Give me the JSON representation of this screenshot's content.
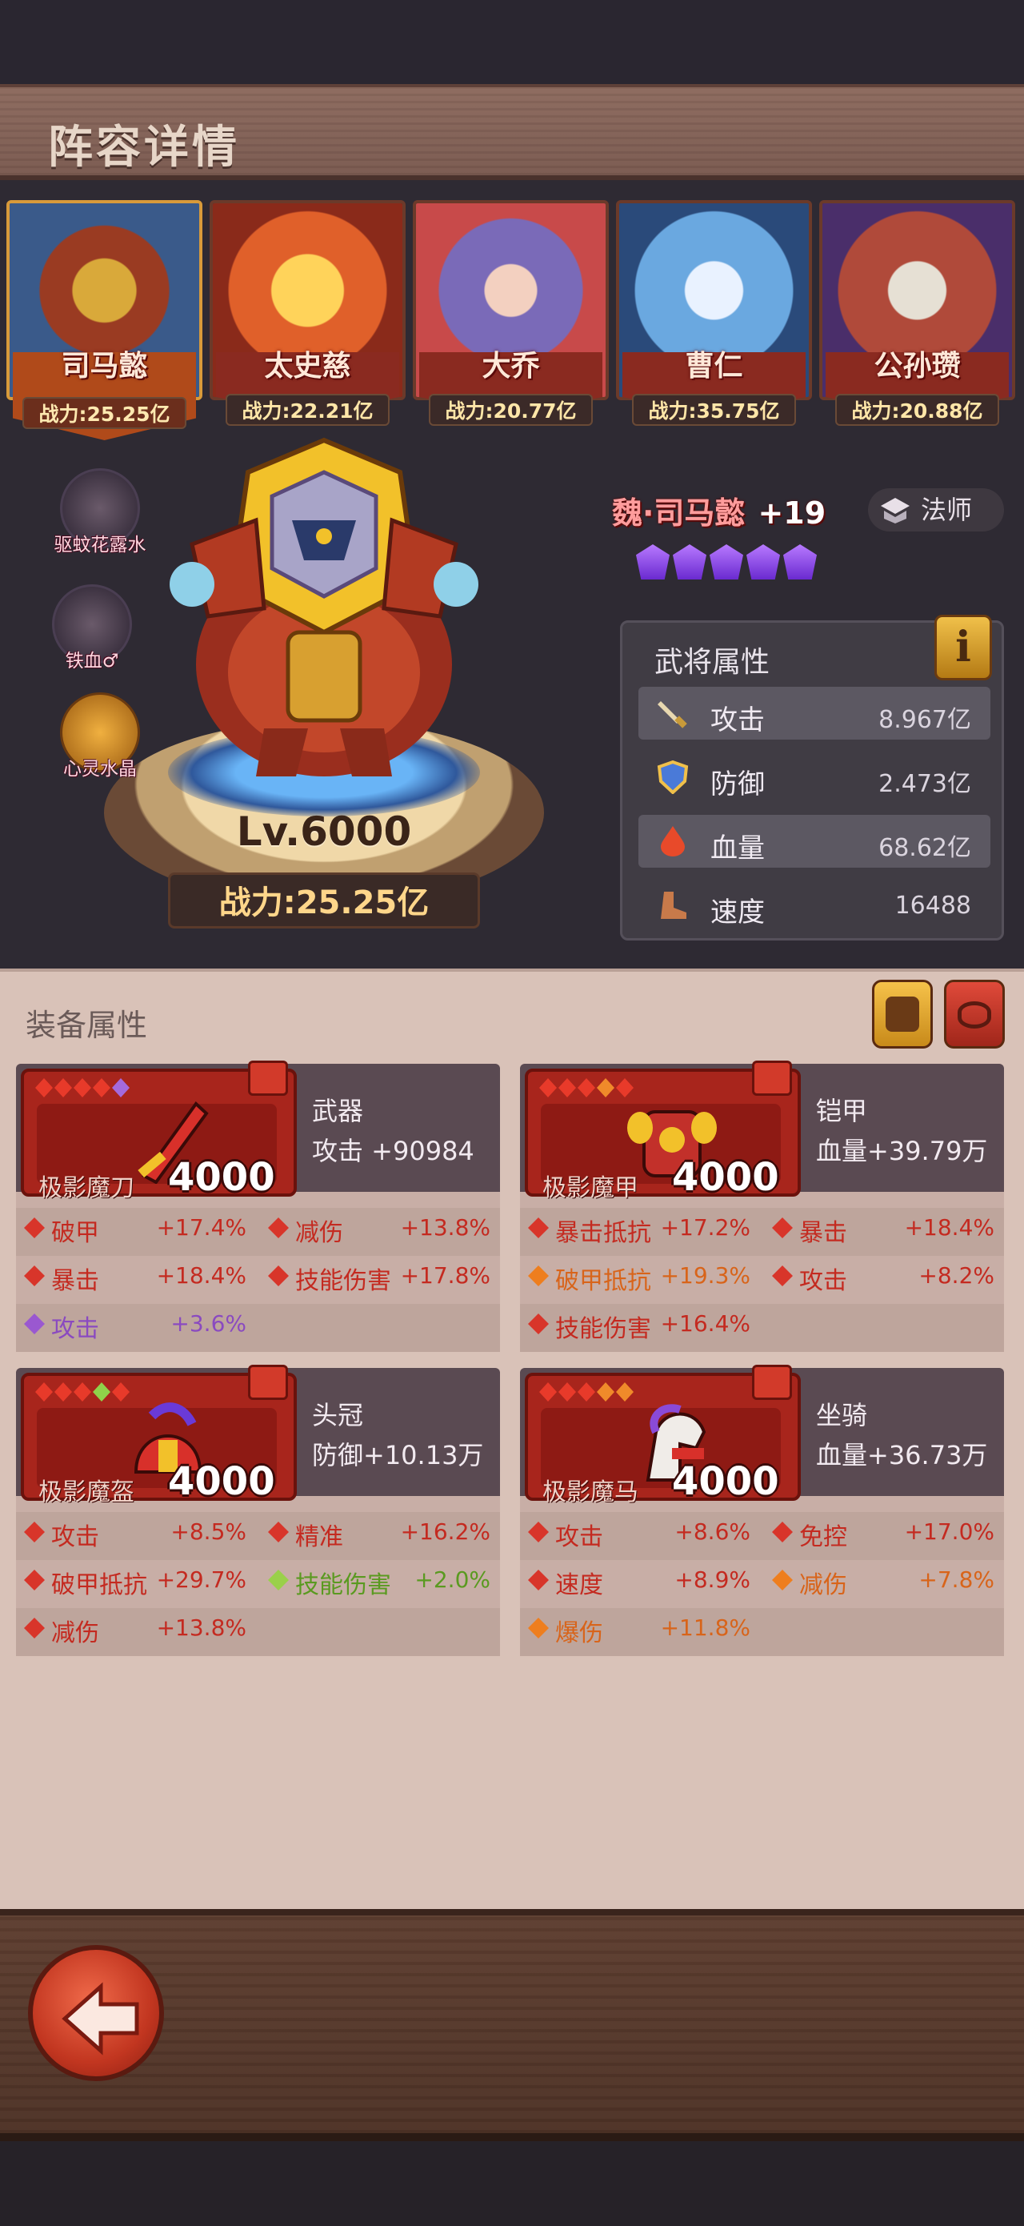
{
  "header": {
    "title": "阵容详情",
    "build_id": "189035361|12772|fba4|28"
  },
  "team": [
    {
      "name": "司马懿",
      "power": "战力:25.25亿",
      "selected": true
    },
    {
      "name": "太史慈",
      "power": "战力:22.21亿",
      "selected": false
    },
    {
      "name": "大乔",
      "power": "战力:20.77亿",
      "selected": false
    },
    {
      "name": "曹仁",
      "power": "战力:35.75亿",
      "selected": false
    },
    {
      "name": "公孙瓒",
      "power": "战力:20.88亿",
      "selected": false
    }
  ],
  "hero": {
    "full_name": "魏·司马懿",
    "plus": "+19",
    "class": "法师",
    "stars": 5,
    "level": "Lv.6000",
    "power": "战力:25.25亿",
    "side_items": [
      {
        "label": "驱蚊花露水",
        "icon": "bottle-icon"
      },
      {
        "label": "铁血♂",
        "icon": "fish-icon"
      },
      {
        "label": "心灵水晶",
        "icon": "crystal-icon"
      }
    ]
  },
  "attributes": {
    "title": "武将属性",
    "info_label": "i",
    "rows": [
      {
        "key": "攻击",
        "value": "8.967亿",
        "icon": "sword-icon"
      },
      {
        "key": "防御",
        "value": "2.473亿",
        "icon": "shield-icon"
      },
      {
        "key": "血量",
        "value": "68.62亿",
        "icon": "blood-drop-icon"
      },
      {
        "key": "速度",
        "value": "16488",
        "icon": "boot-icon"
      }
    ]
  },
  "equipment": {
    "title": "装备属性",
    "items": [
      {
        "slot": "武器",
        "main_stat": "攻击  +90984",
        "name": "极影魔刀",
        "level": "4000",
        "gems": [
          "red",
          "red",
          "red",
          "red",
          "purple"
        ],
        "stats": [
          {
            "k": "破甲",
            "v": "+17.4%",
            "color": "red"
          },
          {
            "k": "减伤",
            "v": "+13.8%",
            "color": "red"
          },
          {
            "k": "暴击",
            "v": "+18.4%",
            "color": "red"
          },
          {
            "k": "技能伤害",
            "v": "+17.8%",
            "color": "red"
          },
          {
            "k": "攻击",
            "v": "+3.6%",
            "color": "purple"
          }
        ]
      },
      {
        "slot": "铠甲",
        "main_stat": "血量+39.79万",
        "name": "极影魔甲",
        "level": "4000",
        "gems": [
          "red",
          "red",
          "red",
          "orange",
          "red"
        ],
        "stats": [
          {
            "k": "暴击抵抗",
            "v": "+17.2%",
            "color": "red"
          },
          {
            "k": "暴击",
            "v": "+18.4%",
            "color": "red"
          },
          {
            "k": "破甲抵抗",
            "v": "+19.3%",
            "color": "orange"
          },
          {
            "k": "攻击",
            "v": "+8.2%",
            "color": "red"
          },
          {
            "k": "技能伤害",
            "v": "+16.4%",
            "color": "red"
          }
        ]
      },
      {
        "slot": "头冠",
        "main_stat": "防御+10.13万",
        "name": "极影魔盔",
        "level": "4000",
        "gems": [
          "red",
          "red",
          "red",
          "green",
          "red"
        ],
        "stats": [
          {
            "k": "攻击",
            "v": "+8.5%",
            "color": "red"
          },
          {
            "k": "精准",
            "v": "+16.2%",
            "color": "red"
          },
          {
            "k": "破甲抵抗",
            "v": "+29.7%",
            "color": "red"
          },
          {
            "k": "技能伤害",
            "v": "+2.0%",
            "color": "green"
          },
          {
            "k": "减伤",
            "v": "+13.8%",
            "color": "red"
          }
        ]
      },
      {
        "slot": "坐骑",
        "main_stat": "血量+36.73万",
        "name": "极影魔马",
        "level": "4000",
        "gems": [
          "red",
          "red",
          "red",
          "orange",
          "orange"
        ],
        "stats": [
          {
            "k": "攻击",
            "v": "+8.6%",
            "color": "red"
          },
          {
            "k": "免控",
            "v": "+17.0%",
            "color": "red"
          },
          {
            "k": "速度",
            "v": "+8.9%",
            "color": "red"
          },
          {
            "k": "减伤",
            "v": "+7.8%",
            "color": "orange"
          },
          {
            "k": "爆伤",
            "v": "+11.8%",
            "color": "orange"
          }
        ]
      }
    ]
  }
}
